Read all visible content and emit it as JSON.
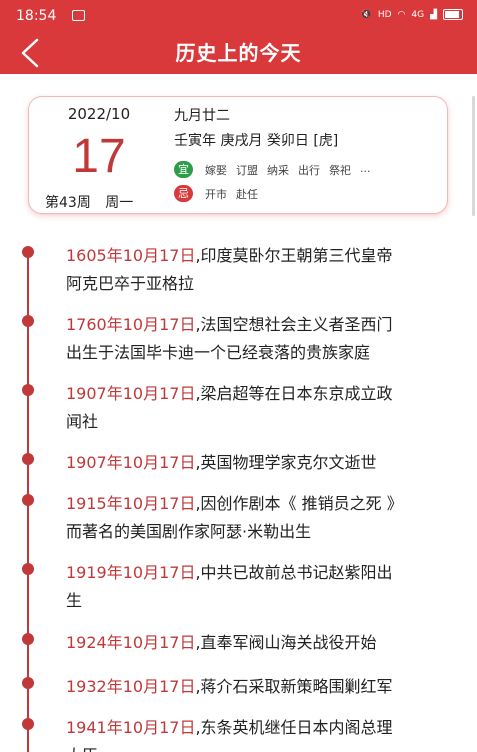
{
  "status_bar": {
    "time": "18:54",
    "network": "HD",
    "signal": "4G"
  },
  "header": {
    "title": "历史上的今天"
  },
  "date_card": {
    "year_month": "2022/10",
    "day": "17",
    "week_number": "第43周",
    "weekday": "周一",
    "lunar_date": "九月廿二",
    "ganzhi": "壬寅年 庚戌月 癸卯日 [虎]",
    "yi_label": "宜",
    "yi_items": [
      "嫁娶",
      "订盟",
      "纳采",
      "出行",
      "祭祀",
      "..."
    ],
    "ji_label": "忌",
    "ji_items": [
      "开市",
      "赴任"
    ]
  },
  "events": [
    {
      "date": "1605年10月17日",
      "text": ",印度莫卧尔王朝第三代皇帝",
      "text2": "阿克巴卒于亚格拉"
    },
    {
      "date": "1760年10月17日",
      "text": ",法国空想社会主义者圣西门",
      "text2": "出生于法国毕卡迪一个已经衰落的贵族家庭"
    },
    {
      "date": "1907年10月17日",
      "text": ",梁启超等在日本东京成立政",
      "text2": "闻社"
    },
    {
      "date": "1907年10月17日",
      "text": ",英国物理学家克尔文逝世",
      "text2": ""
    },
    {
      "date": "1915年10月17日",
      "text": ",因创作剧本《 推销员之死 》",
      "text2": "而著名的美国剧作家阿瑟·米勒出生"
    },
    {
      "date": "1919年10月17日",
      "text": ",中共已故前总书记赵紫阳出",
      "text2": "生"
    },
    {
      "date": "1924年10月17日",
      "text": ",直奉军阀山海关战役开始",
      "text2": ""
    },
    {
      "date": "1932年10月17日",
      "text": ",蒋介石采取新策略围剿红军",
      "text2": ""
    },
    {
      "date": "1941年10月17日",
      "text": ",东条英机继任日本内阁总理",
      "text2": "大臣"
    }
  ],
  "colors": {
    "brand": "#d9393b",
    "date_red": "#c0383a",
    "yi_green": "#2e9d4a"
  }
}
